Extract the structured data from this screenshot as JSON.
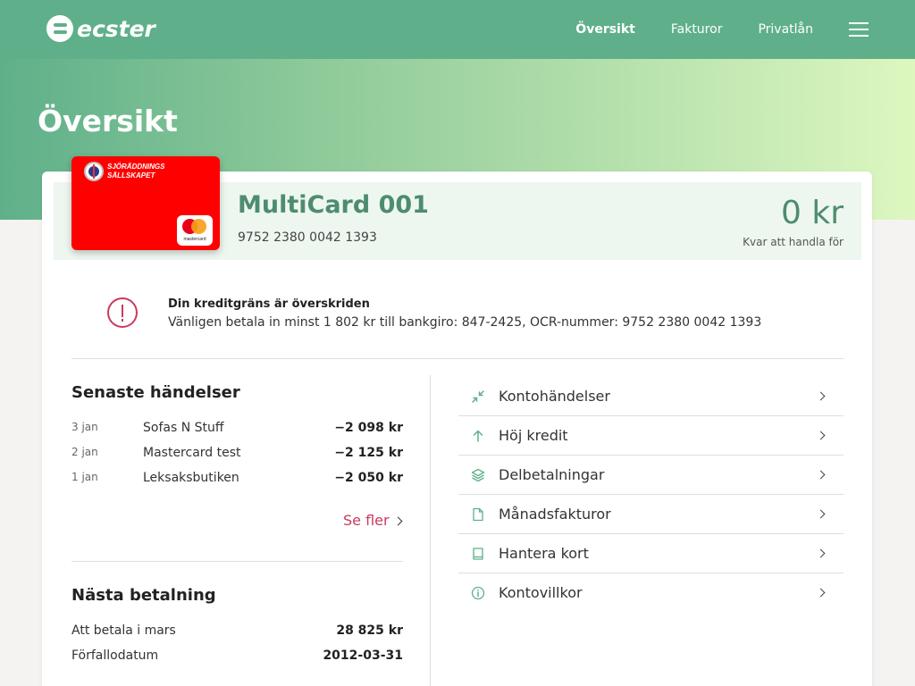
{
  "nav": {
    "logo_text": "ecster",
    "links": [
      "Översikt",
      "Fakturor",
      "Privatlån"
    ]
  },
  "page": {
    "title": "Översikt"
  },
  "card": {
    "brand_line1": "SJÖRÄDDNINGS",
    "brand_line2": "SÄLLSKAPET",
    "network": "mastercard",
    "name": "MultiCard 001",
    "number": "9752 2380 0042 1393",
    "balance": "0 kr",
    "balance_label": "Kvar att handla för"
  },
  "alert": {
    "title": "Din kreditgräns är överskriden",
    "text": "Vänligen betala in minst 1 802 kr till bankgiro: 847-2425, OCR-nummer: 9752 2380 0042 1393"
  },
  "recent": {
    "title": "Senaste händelser",
    "items": [
      {
        "date": "3 jan",
        "merchant": "Sofas N Stuff",
        "amount": "−2 098 kr"
      },
      {
        "date": "2 jan",
        "merchant": "Mastercard test",
        "amount": "−2 125 kr"
      },
      {
        "date": "1 jan",
        "merchant": "Leksaksbutiken",
        "amount": "−2 050 kr"
      }
    ],
    "see_more": "Se fler"
  },
  "next_payment": {
    "title": "Nästa betalning",
    "rows": [
      {
        "label": "Att betala i mars",
        "value": "28 825 kr"
      },
      {
        "label": "Förfallodatum",
        "value": "2012-03-31"
      }
    ]
  },
  "menu": {
    "items": [
      {
        "label": "Kontohändelser",
        "icon": "compress-arrows-icon"
      },
      {
        "label": "Höj kredit",
        "icon": "arrow-up-icon"
      },
      {
        "label": "Delbetalningar",
        "icon": "layers-icon"
      },
      {
        "label": "Månadsfakturor",
        "icon": "document-icon"
      },
      {
        "label": "Hantera kort",
        "icon": "book-icon"
      },
      {
        "label": "Kontovillkor",
        "icon": "info-icon"
      }
    ]
  },
  "colors": {
    "nav_green": "#5fb08a",
    "accent_green": "#4e8c6e",
    "alert_pink": "#c93b5f",
    "card_red": "#ff0000"
  }
}
